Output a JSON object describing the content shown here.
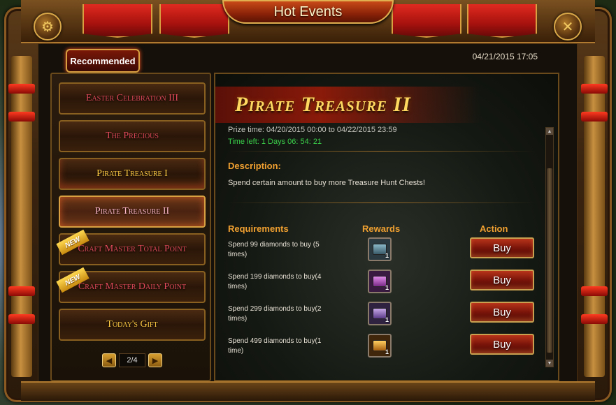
{
  "header": {
    "title": "Hot Events",
    "settings_icon": "gear-icon",
    "close_icon": "close-icon"
  },
  "tab": {
    "recommended": "Recommended"
  },
  "datetime": "04/21/2015 17:05",
  "sidebar": {
    "items": [
      {
        "label": "Easter Celebration III",
        "new": false
      },
      {
        "label": "The Precious",
        "new": false
      },
      {
        "label": "Pirate Treasure I",
        "new": false
      },
      {
        "label": "Pirate Treasure II",
        "new": false
      },
      {
        "label": "Craft Master Total Point",
        "new": true
      },
      {
        "label": "Craft Master Daily Point",
        "new": true
      },
      {
        "label": "Today's Gift",
        "new": false
      }
    ],
    "new_badge": "NEW",
    "pager": {
      "prev": "◀",
      "page": "2/4",
      "next": "▶"
    }
  },
  "event": {
    "title": "Pirate Treasure II",
    "prize_time": "Prize time: 04/20/2015 00:00 to 04/22/2015 23:59",
    "time_left": "Time left: 1 Days  06: 54: 21",
    "description_title": "Description:",
    "description": "Spend certain amount to buy more Treasure Hunt Chests!",
    "columns": {
      "requirements": "Requirements",
      "rewards": "Rewards",
      "action": "Action"
    },
    "rows": [
      {
        "requirement": "Spend 99 diamonds to buy (5 times)",
        "chest_color": "#5a8a9a",
        "qty": "1",
        "action": "Buy"
      },
      {
        "requirement": "Spend 199 diamonds to buy(4 times)",
        "chest_color": "#b04ab8",
        "qty": "1",
        "action": "Buy"
      },
      {
        "requirement": "Spend 299 diamonds to buy(2 times)",
        "chest_color": "#9a6ab8",
        "qty": "1",
        "action": "Buy"
      },
      {
        "requirement": "Spend 499 diamonds to buy(1 time)",
        "chest_color": "#d88a20",
        "qty": "1",
        "action": "Buy"
      }
    ]
  }
}
